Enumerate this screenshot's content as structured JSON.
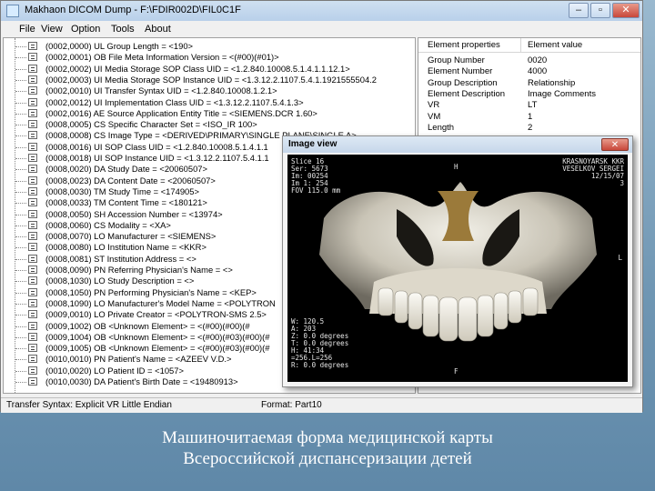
{
  "window": {
    "title": "Makhaon DICOM Dump - F:\\FDIR002D\\FIL0C1F",
    "minimize_icon": "minimize-icon",
    "restore_icon": "restore-icon",
    "close_icon": "close-icon"
  },
  "menu": [
    "File",
    "View",
    "Option",
    "Tools",
    "About"
  ],
  "tree": [
    "(0002,0000) UL Group Length = <190>",
    "(0002,0001) OB File Meta Information Version = <(#00)(#01)>",
    "(0002,0002) UI Media Storage SOP Class UID = <1.2.840.10008.5.1.4.1.1.12.1>",
    "(0002,0003) UI Media Storage SOP Instance UID = <1.3.12.2.1107.5.4.1.1921555504.2",
    "(0002,0010) UI Transfer Syntax UID = <1.2.840.10008.1.2.1>",
    "(0002,0012) UI Implementation Class UID = <1.3.12.2.1107.5.4.1.3>",
    "(0002,0016) AE Source Application Entity Title = <SIEMENS.DCR 1.60>",
    "(0008,0005) CS Specific Character Set = <ISO_IR 100>",
    "(0008,0008) CS Image Type = <DERIVED\\PRIMARY\\SINGLE PLANE\\SINGLE A>",
    "(0008,0016) UI SOP Class UID = <1.2.840.10008.5.1.4.1.1",
    "(0008,0018) UI SOP Instance UID = <1.3.12.2.1107.5.4.1.1",
    "(0008,0020) DA Study Date = <20060507>",
    "(0008,0023) DA Content Date = <20060507>",
    "(0008,0030) TM Study Time = <174905>",
    "(0008,0033) TM Content Time = <180121>",
    "(0008,0050) SH Accession Number = <13974>",
    "(0008,0060) CS Modality = <XA>",
    "(0008,0070) LO Manufacturer = <SIEMENS>",
    "(0008,0080) LO Institution Name = <KKR>",
    "(0008,0081) ST Institution Address = <>",
    "(0008,0090) PN Referring Physician's Name = <>",
    "(0008,1030) LO Study Description = <>",
    "(0008,1050) PN Performing Physician's Name = <KEP>",
    "(0008,1090) LO Manufacturer's Model Name = <POLYTRON",
    "(0009,0010) LO Private Creator = <POLYTRON-SMS 2.5>",
    "(0009,1002) OB <Unknown Element> = <(#00)(#00)(#",
    "(0009,1004) OB <Unknown Element> = <(#00)(#03)(#00)(#",
    "(0009,1005) OB <Unknown Element> = <(#00)(#03)(#00)(#",
    "(0010,0010) PN Patient's Name = <AZEEV V.D.>",
    "(0010,0020) LO Patient ID = <1057>",
    "(0010,0030) DA Patient's Birth Date = <19480913>"
  ],
  "props": {
    "header": [
      "Element properties",
      "Element value"
    ],
    "rows": [
      [
        "Group Number",
        "0020"
      ],
      [
        "Element Number",
        "4000"
      ],
      [
        "Group Description",
        "Relationship"
      ],
      [
        "Element Description",
        "Image Comments"
      ],
      [
        "VR",
        "LT"
      ],
      [
        "VM",
        "1"
      ],
      [
        "Length",
        "2"
      ]
    ]
  },
  "status": {
    "transfer": "Transfer Syntax: Explicit VR Little Endian",
    "format": "Format: Part10"
  },
  "image_window": {
    "title": "Image view",
    "close_icon": "close-icon",
    "overlay": {
      "top_left": [
        "Slice 16",
        "Ser: 5673",
        "Im: 00254",
        "Im 1: 254",
        "FOV 115.0 mm"
      ],
      "top_center": "H",
      "top_right": [
        "KRASNOYARSK KKR",
        "VESELKOV SERGEI",
        "12/15/07",
        "3"
      ],
      "right_mid": "L",
      "bottom_left": [
        "W: 120.5",
        "A: 203",
        "Z: 0.0 degrees",
        "T: 0.0 degrees",
        "H: 41:34",
        "=256.L=256",
        "R: 0.0 degrees"
      ],
      "bottom_center": "F"
    }
  },
  "caption": {
    "line1": "Машиночитаемая форма медицинской карты",
    "line2": "Всероссийской диспансеризации детей"
  }
}
